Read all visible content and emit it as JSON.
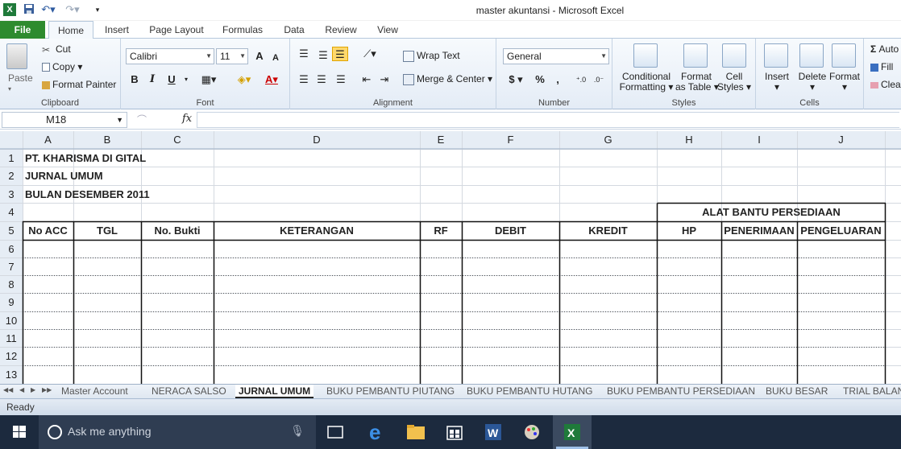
{
  "window": {
    "title": "master akuntansi  -  Microsoft Excel"
  },
  "quick_access": {
    "app_icon": "excel-icon",
    "save_icon": "save-icon",
    "undo_icon": "undo-icon",
    "redo_icon": "redo-icon",
    "customize_icon": "customize-icon"
  },
  "ribbon_tabs": [
    {
      "label": "File"
    },
    {
      "label": "Home"
    },
    {
      "label": "Insert"
    },
    {
      "label": "Page Layout"
    },
    {
      "label": "Formulas"
    },
    {
      "label": "Data"
    },
    {
      "label": "Review"
    },
    {
      "label": "View"
    }
  ],
  "clipboard": {
    "paste": "Paste",
    "cut": "Cut",
    "copy": "Copy",
    "format_painter": "Format Painter",
    "label": "Clipboard"
  },
  "font": {
    "name": "Calibri",
    "size": "11",
    "grow": "A",
    "shrink": "A",
    "bold": "B",
    "italic": "I",
    "underline": "U",
    "label": "Font"
  },
  "alignment": {
    "wrap_text": "Wrap Text",
    "merge_center": "Merge & Center",
    "label": "Alignment"
  },
  "number": {
    "format": "General",
    "currency": "$",
    "percent": "%",
    "comma": ",",
    "label": "Number"
  },
  "styles": {
    "conditional": [
      "Conditional",
      "Formatting"
    ],
    "format_table": [
      "Format",
      "as Table"
    ],
    "cell_styles": [
      "Cell",
      "Styles"
    ],
    "label": "Styles"
  },
  "cells": {
    "insert": "Insert",
    "delete": "Delete",
    "format": "Format",
    "label": "Cells"
  },
  "editing": {
    "autosum": "Auto",
    "fill": "Fill",
    "clear": "Clea"
  },
  "formula_bar": {
    "name_box": "M18",
    "fx": "fx",
    "value": ""
  },
  "columns": [
    "A",
    "B",
    "C",
    "D",
    "E",
    "F",
    "G",
    "H",
    "I",
    "J"
  ],
  "rows": [
    "1",
    "2",
    "3",
    "4",
    "5",
    "6",
    "7",
    "8",
    "9",
    "10",
    "11",
    "12",
    "13"
  ],
  "sheet": {
    "a1": "PT. KHARISMA DI GITAL",
    "a2": "JURNAL UMUM",
    "a3": "BULAN DESEMBER 2011",
    "h4": "ALAT BANTU PERSEDIAAN",
    "headers": [
      "No ACC",
      "TGL",
      "No. Bukti",
      "KETERANGAN",
      "RF",
      "DEBIT",
      "KREDIT",
      "HP",
      "PENERIMAAN",
      "PENGELUARAN"
    ]
  },
  "sheet_tabs": [
    {
      "label": "Master Account"
    },
    {
      "label": "NERACA SALSO"
    },
    {
      "label": "JURNAL UMUM"
    },
    {
      "label": "BUKU PEMBANTU PIUTANG"
    },
    {
      "label": "BUKU PEMBANTU HUTANG"
    },
    {
      "label": "BUKU PEMBANTU PERSEDIAAN"
    },
    {
      "label": "BUKU BESAR"
    },
    {
      "label": "TRIAL BALAN"
    }
  ],
  "status": {
    "text": "Ready"
  },
  "taskbar": {
    "search_placeholder": "Ask me anything"
  },
  "colors": {
    "file_tab": "#2e8b2e",
    "taskbar": "#1c2a3e",
    "header_bg": "#e3eaf3"
  }
}
